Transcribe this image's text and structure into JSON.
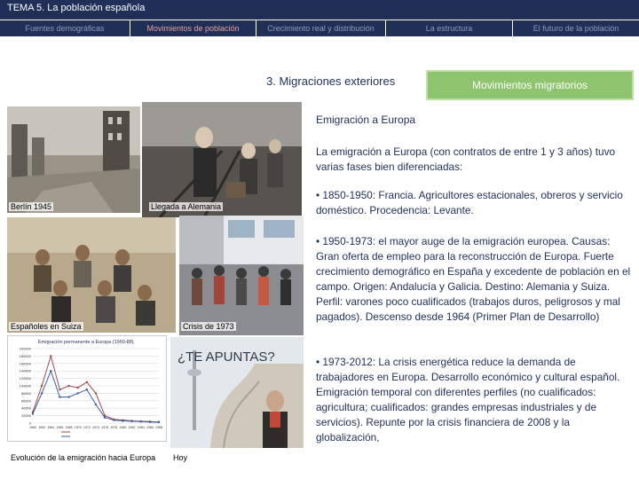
{
  "header": {
    "title": "TEMA 5. La población española"
  },
  "nav": {
    "tabs": [
      {
        "label": "Fuentes demográficas",
        "active": false
      },
      {
        "label": "Movimientos de población",
        "active": true
      },
      {
        "label": "Crecimiento real y distribución",
        "active": false
      },
      {
        "label": "La estructura",
        "active": false
      },
      {
        "label": "El futuro de la población",
        "active": false
      }
    ]
  },
  "content": {
    "section_heading": "3. Migraciones exteriores",
    "badge": "Movimientos migratorios",
    "subheading": "Emigración a Europa",
    "intro": "La emigración a Europa (con contratos de entre 1 y 3 años) tuvo varias fases bien diferenciadas:",
    "phases": [
      "• 1850-1950: Francia. Agricultores estacionales, obreros y servicio doméstico. Procedencia: Levante.",
      "• 1950-1973: el mayor auge de la emigración europea. Causas: Gran oferta de empleo para la reconstrucción de Europa. Fuerte crecimiento demográfico en España y excedente de población en el campo. Origen: Andalucía y Galicia. Destino: Alemania y Suiza. Perfil: varones poco cualificados (trabajos duros, peligrosos y mal pagados). Descenso desde 1964 (Primer Plan de Desarrollo)",
      "• 1973-2012: La crisis energética reduce la demanda de trabajadores en Europa. Desarrollo económico y cultural español. Emigración temporal con diferentes perfiles (no cualificados: agricultura; cualificados: grandes empresas industriales y de servicios). Repunte por la crisis financiera de 2008 y la globalización,"
    ]
  },
  "photos": {
    "berlin": {
      "caption": "Berlín 1945"
    },
    "arrival": {
      "caption": "Llegada a Alemania"
    },
    "swiss": {
      "caption": "Españoles en Suiza"
    },
    "crisis": {
      "caption": "Crisis de 1973"
    },
    "chart": {
      "caption": "Evolución de la emigración hacia Europa"
    },
    "today": {
      "caption": "Hoy",
      "headline": "¿TE APUNTAS?"
    }
  },
  "chart_data": {
    "type": "line",
    "title": "Emigración permanente a Europa (1960-88)",
    "x": [
      "1960",
      "1962",
      "1964",
      "1966",
      "1968",
      "1970",
      "1972",
      "1974",
      "1976",
      "1978",
      "1980",
      "1982",
      "1984",
      "1986",
      "1988"
    ],
    "series": [
      {
        "name": "",
        "values": [
          30000,
          100000,
          180000,
          90000,
          100000,
          95000,
          110000,
          80000,
          20000,
          10000,
          8000,
          6000,
          5000,
          4000,
          3000
        ]
      },
      {
        "name": "",
        "values": [
          25000,
          80000,
          140000,
          70000,
          70000,
          80000,
          90000,
          50000,
          15000,
          8000,
          6000,
          5000,
          4000,
          3000,
          2500
        ]
      }
    ],
    "yticks": [
      "200000",
      "180000",
      "160000",
      "140000",
      "120000",
      "100000",
      "80000",
      "60000",
      "40000",
      "20000",
      "0"
    ],
    "ylim": [
      0,
      200000
    ],
    "grid": true,
    "legend": "bottom",
    "colors": [
      "#9b4a4a",
      "#3a5fa0"
    ]
  },
  "colors": {
    "navy": "#1f2f57",
    "active_tab": "#e8a09a",
    "inactive_tab": "#8e9bb8",
    "badge_green": "#8fc46e"
  }
}
